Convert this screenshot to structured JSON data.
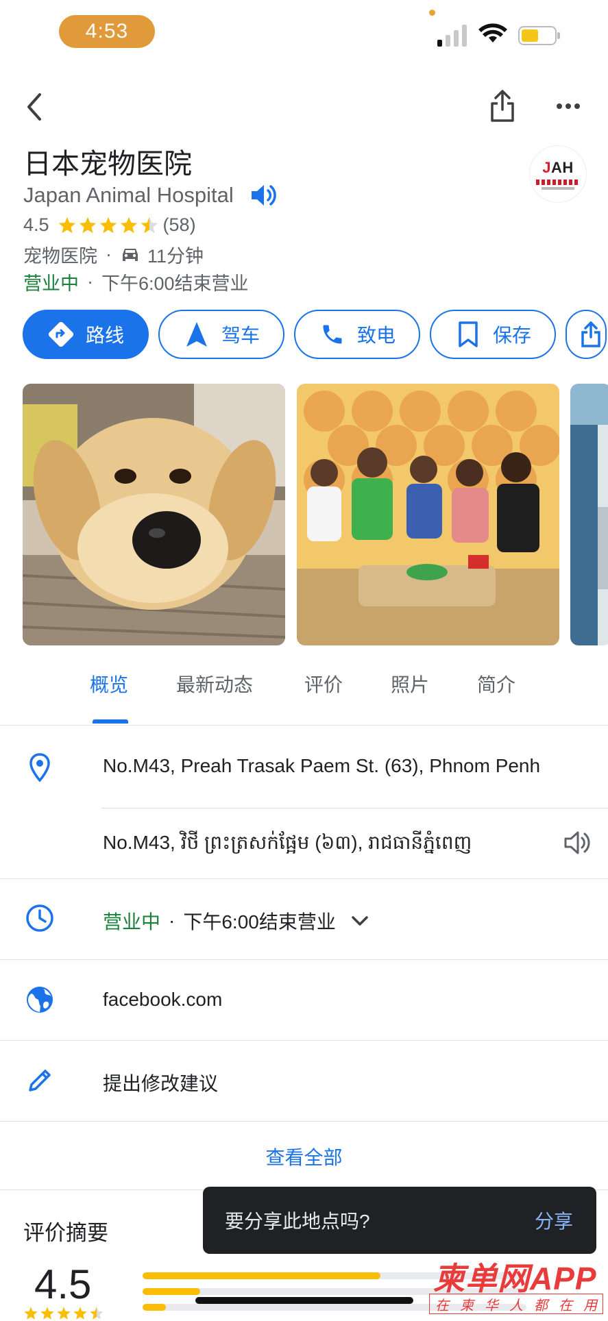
{
  "status_bar": {
    "time": "4:53",
    "icons": [
      "cellular-signal-icon",
      "wifi-icon",
      "battery-icon"
    ]
  },
  "header": {
    "back_icon": "chevron-left-icon",
    "share_icon": "share-icon",
    "more_icon": "more-horizontal-icon"
  },
  "place": {
    "name": "日本宠物医院",
    "name_en": "Japan Animal Hospital",
    "rating": "4.5",
    "stars": 4.5,
    "review_count": "(58)",
    "category": "宠物医院",
    "drive_time": "11分钟",
    "open_status": "营业中",
    "hours_text": "下午6:00结束营业",
    "logo_text": "JAH"
  },
  "actions": [
    {
      "label": "路线",
      "icon": "directions-icon"
    },
    {
      "label": "驾车",
      "icon": "navigation-arrow-icon"
    },
    {
      "label": "致电",
      "icon": "phone-icon"
    },
    {
      "label": "保存",
      "icon": "bookmark-icon"
    }
  ],
  "tabs": [
    "概览",
    "最新动态",
    "评价",
    "照片",
    "简介"
  ],
  "active_tab": "概览",
  "info": {
    "address": "No.M43, Preah Trasak Paem St. (63), Phnom Penh",
    "address_local": "No.M43, វិថី ព្រះត្រសក់ផ្អែម (៦៣), រាជធានីភ្នំពេញ",
    "hours_status": "营业中",
    "hours_text": "下午6:00结束营业",
    "website": "facebook.com",
    "suggest_edit": "提出修改建议",
    "view_all": "查看全部"
  },
  "reviews": {
    "title": "评价摘要",
    "rating": "4.5",
    "distribution": [
      0.62,
      0.15,
      0.06
    ]
  },
  "toast": {
    "message": "要分享此地点吗?",
    "action": "分享"
  },
  "watermark": {
    "main": "柬单网APP",
    "sub": [
      "在",
      "柬",
      "华",
      "人",
      "都",
      "在",
      "用"
    ]
  },
  "colors": {
    "accent": "#1a73e8",
    "open": "#188038",
    "star": "#fbbc04",
    "toast_bg": "#202124",
    "time_pill": "#e09a3a",
    "watermark": "#e83b3b"
  }
}
